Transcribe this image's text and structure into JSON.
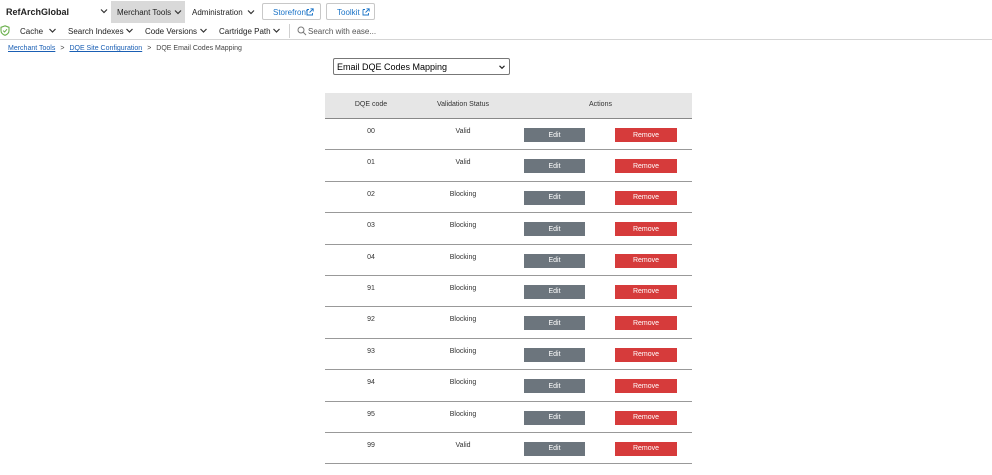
{
  "topbar": {
    "brand": "RefArchGlobal",
    "tabs": [
      {
        "label": "Merchant Tools"
      },
      {
        "label": "Administration"
      }
    ],
    "storefront_label": "Storefront",
    "toolkit_label": "Toolkit"
  },
  "subbar": {
    "items": [
      "Cache",
      "Search Indexes",
      "Code Versions",
      "Cartridge Path"
    ],
    "search_placeholder": "Search with ease..."
  },
  "breadcrumb": {
    "items": [
      "Merchant Tools",
      "DQE Site Configuration"
    ],
    "current": "DQE Email Codes Mapping",
    "separator": ">"
  },
  "mapping_select": {
    "selected": "Email DQE Codes Mapping"
  },
  "table": {
    "headers": {
      "code": "DQE code",
      "status": "Validation Status",
      "actions": "Actions"
    },
    "edit_label": "Edit",
    "remove_label": "Remove",
    "rows": [
      {
        "code": "00",
        "status": "Valid"
      },
      {
        "code": "01",
        "status": "Valid"
      },
      {
        "code": "02",
        "status": "Blocking"
      },
      {
        "code": "03",
        "status": "Blocking"
      },
      {
        "code": "04",
        "status": "Blocking"
      },
      {
        "code": "91",
        "status": "Blocking"
      },
      {
        "code": "92",
        "status": "Blocking"
      },
      {
        "code": "93",
        "status": "Blocking"
      },
      {
        "code": "94",
        "status": "Blocking"
      },
      {
        "code": "95",
        "status": "Blocking"
      },
      {
        "code": "99",
        "status": "Valid"
      }
    ]
  },
  "colors": {
    "edit_button": "#6c757d",
    "remove_button": "#d63b3b",
    "link": "#1a5fb4",
    "active_tab": "#d9d9d9",
    "header_bg": "#e6e6e6"
  }
}
